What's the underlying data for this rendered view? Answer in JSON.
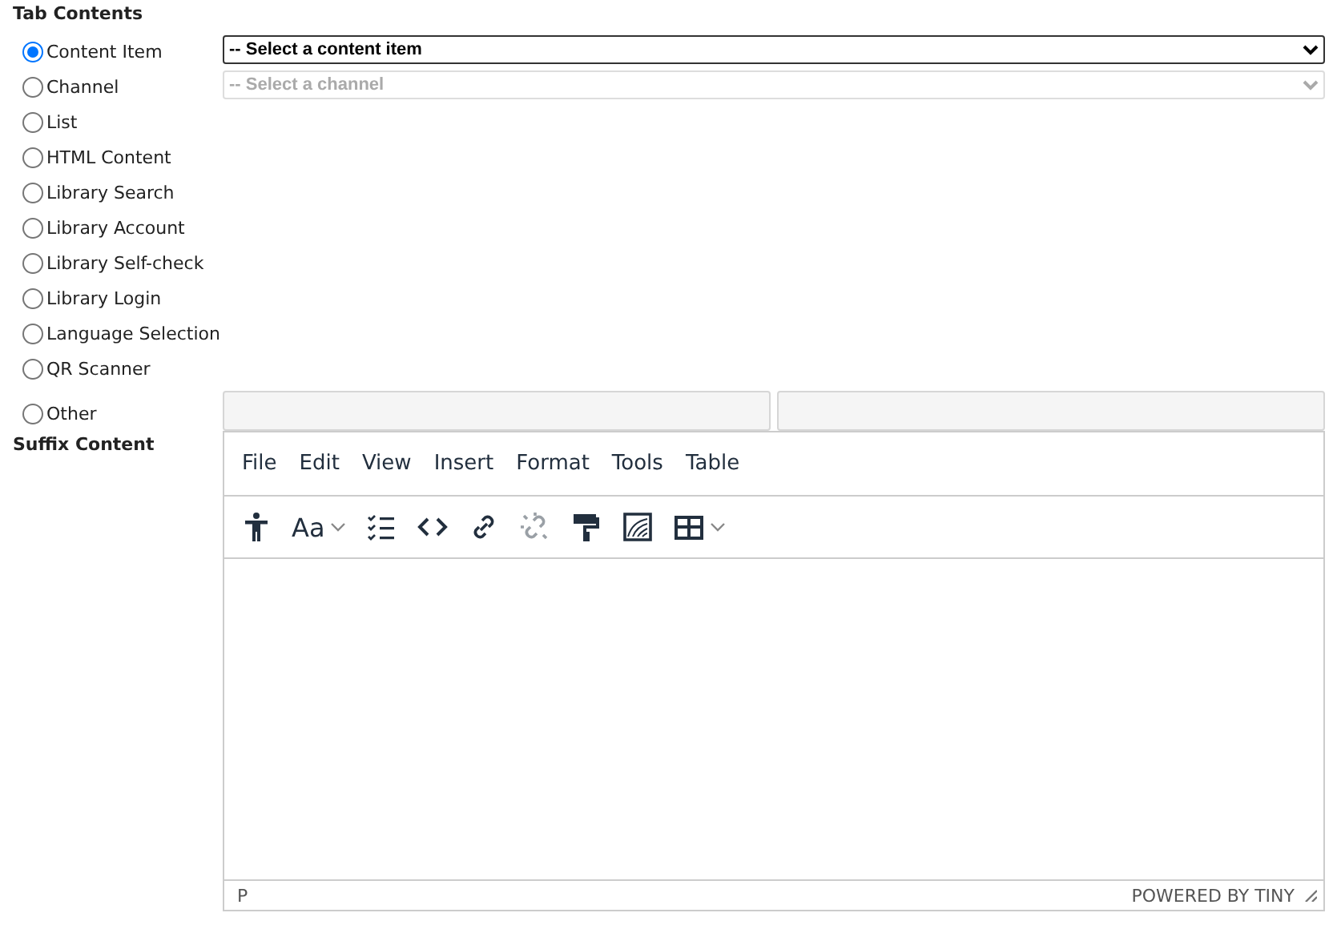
{
  "tab_contents": {
    "heading": "Tab Contents",
    "options": [
      {
        "label": "Content Item",
        "selected": true,
        "kind": "select",
        "select": {
          "text": "-- Select a content item",
          "disabled": false
        }
      },
      {
        "label": "Channel",
        "selected": false,
        "kind": "select",
        "select": {
          "text": "-- Select a channel",
          "disabled": true
        }
      },
      {
        "label": "List",
        "selected": false,
        "kind": "plain"
      },
      {
        "label": "HTML Content",
        "selected": false,
        "kind": "plain"
      },
      {
        "label": "Library Search",
        "selected": false,
        "kind": "plain"
      },
      {
        "label": "Library Account",
        "selected": false,
        "kind": "plain"
      },
      {
        "label": "Library Self-check",
        "selected": false,
        "kind": "plain"
      },
      {
        "label": "Library Login",
        "selected": false,
        "kind": "plain"
      },
      {
        "label": "Language Selection",
        "selected": false,
        "kind": "plain"
      },
      {
        "label": "QR Scanner",
        "selected": false,
        "kind": "plain"
      },
      {
        "label": "Other",
        "selected": false,
        "kind": "fields"
      }
    ]
  },
  "suffix_content": {
    "heading": "Suffix Content",
    "editor": {
      "menu": [
        "File",
        "Edit",
        "View",
        "Insert",
        "Format",
        "Tools",
        "Table"
      ],
      "toolbar": [
        {
          "kind": "accessibility",
          "disabled": false
        },
        {
          "kind": "font-size",
          "label": "Aa",
          "disabled": false
        },
        {
          "kind": "checklist",
          "disabled": false
        },
        {
          "kind": "code",
          "disabled": false
        },
        {
          "kind": "link",
          "disabled": false
        },
        {
          "kind": "unlink",
          "disabled": true
        },
        {
          "kind": "format-painter",
          "disabled": false
        },
        {
          "kind": "image",
          "disabled": false
        },
        {
          "kind": "table",
          "disabled": false
        }
      ],
      "status_path": "P",
      "branding": "POWERED BY TINY"
    }
  }
}
